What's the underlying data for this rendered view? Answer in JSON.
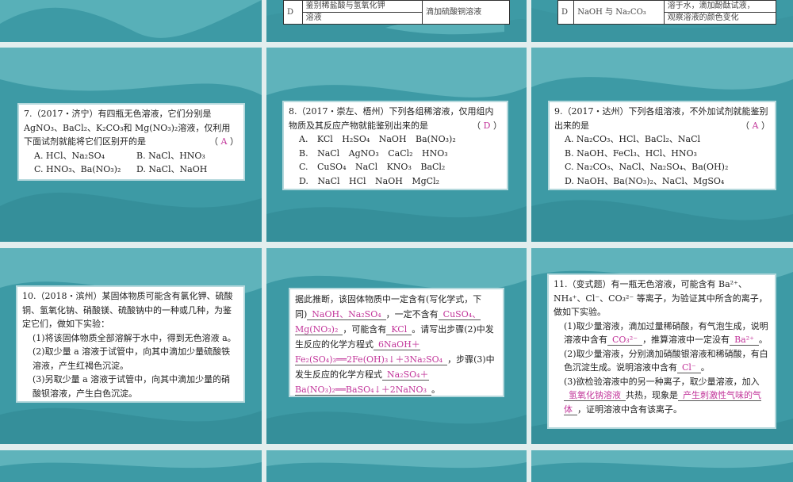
{
  "colors": {
    "slide_bg": "#3d9aa5",
    "answer": "#c2359a",
    "gap": "#e2eeee"
  },
  "top_row": {
    "slide2": {
      "label": "D",
      "col1": [
        "鉴别稀盐酸与氢氧化钾",
        "溶液"
      ],
      "col2": "滴加硫酸铜溶液"
    },
    "slide3": {
      "label": "D",
      "col1": "NaOH 与 Na₂CO₃",
      "col2": [
        "溶于水，滴加酚酞试液，",
        "观察溶液的颜色变化"
      ]
    }
  },
  "q7": {
    "stem": "7.（2017・济宁）有四瓶无色溶液，它们分别是AgNO₃、BaCl₂、K₂CO₃和 Mg(NO₃)₂溶液，仅利用下面试剂就能将它们区别开的是",
    "answer": "A",
    "options": [
      "A. HCl、Na₂SO₄",
      "B. NaCl、HNO₃",
      "C. HNO₃、Ba(NO₃)₂",
      "D. NaCl、NaOH"
    ]
  },
  "q8": {
    "stem": "8.（2017・崇左、梧州）下列各组稀溶液，仅用组内物质及其反应产物就能鉴别出来的是",
    "answer": "D",
    "options": [
      "A. KCl  H₂SO₄  NaOH  Ba(NO₃)₂",
      "B. NaCl  AgNO₃  CaCl₂  HNO₃",
      "C. CuSO₄  NaCl  KNO₃  BaCl₂",
      "D. NaCl  HCl  NaOH  MgCl₂"
    ]
  },
  "q9": {
    "stem": "9.（2017・达州）下列各组溶液，不外加试剂就能鉴别出来的是",
    "answer": "A",
    "options": [
      "A. Na₂CO₃、HCl、BaCl₂、NaCl",
      "B. NaOH、FeCl₃、HCl、HNO₃",
      "C. Na₂CO₃、NaCl、Na₂SO₄、Ba(OH)₂",
      "D. NaOH、Ba(NO₃)₂、NaCl、MgSO₄"
    ]
  },
  "q10": {
    "stem": "10.（2018・滨州）某固体物质可能含有氯化钾、硫酸铜、氢氧化钠、硝酸镁、硫酸钠中的一种或几种，为鉴定它们，做如下实验：",
    "steps": [
      "(1)将该固体物质全部溶解于水中，得到无色溶液 a。",
      "(2)取少量 a 溶液于试管中，向其中滴加少量硫酸铁溶液，产生红褐色沉淀。",
      "(3)另取少量 a 溶液于试管中，向其中滴加少量的硝酸钡溶液，产生白色沉淀。"
    ]
  },
  "q10b": {
    "t1": "据此推断，该固体物质中一定含有(写化学式，下同)",
    "a1": "NaOH、Na₂SO₄",
    "t2": "，一定不含有",
    "a2": "CuSO₄、Mg(NO₃)₂",
    "t3": "，可能含有",
    "a3": "KCl",
    "t4": "。请写出步骤(2)中发生反应的化学方程式",
    "a4": "6NaOH＋Fe₂(SO₄)₃══2Fe(OH)₃↓＋3Na₂SO₄",
    "t5": "，步骤(3)中发生反应的化学方程式",
    "a5": "Na₂SO₄＋Ba(NO₃)₂══BaSO₄↓＋2NaNO₃",
    "t6": "。"
  },
  "q11": {
    "stem": "11.（变式题）有一瓶无色溶液，可能含有 Ba²⁺、NH₄⁺、Cl⁻、CO₃²⁻ 等离子，为验证其中所含的离子，做如下实验。",
    "s1a": "(1)取少量溶液，滴加过量稀硝酸，有气泡生成，说明溶液中含有",
    "s1ans": "CO₃²⁻",
    "s1b": "，推算溶液中一定没有",
    "s1ans2": "Ba²⁺",
    "s1c": "。",
    "s2a": "(2)取少量溶液，分别滴加硝酸银溶液和稀硝酸，有白色沉淀生成。说明溶液中含有",
    "s2ans": "Cl⁻",
    "s2b": "。",
    "s3a": "(3)欲检验溶液中的另一种离子，取少量溶液，加入",
    "s3ans": "氢氧化钠溶液",
    "s3b": "共热，现象是",
    "s3ans2": "产生刺激性气味的气体",
    "s3c": "，证明溶液中含有该离子。"
  }
}
